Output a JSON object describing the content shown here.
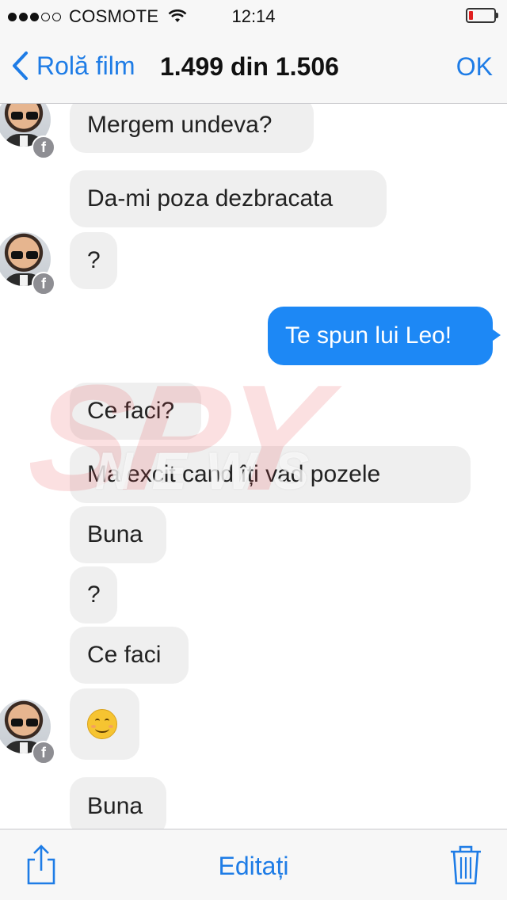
{
  "status_bar": {
    "signal_dots_full": 3,
    "signal_dots_total": 5,
    "carrier": "COSMOTE",
    "wifi_icon": "wifi-icon",
    "time": "12:14",
    "battery_icon": "battery-low-icon",
    "battery_color": "#e02020"
  },
  "nav": {
    "back_label": "Rolă film",
    "title": "1.499 din 1.506",
    "ok_label": "OK",
    "accent_color": "#1e7ce6"
  },
  "messages": [
    {
      "direction": "in",
      "text": "Mergem undeva?",
      "avatar": true
    },
    {
      "direction": "in",
      "text": "Da-mi poza dezbracata",
      "avatar": false
    },
    {
      "direction": "in",
      "text": "?",
      "avatar": true
    },
    {
      "direction": "out",
      "text": "Te spun lui Leo!"
    },
    {
      "direction": "in",
      "text": "Ce faci?",
      "avatar": false
    },
    {
      "direction": "in",
      "text": "Ma excit cand îți vad pozele",
      "avatar": false
    },
    {
      "direction": "in",
      "text": "Buna",
      "avatar": false
    },
    {
      "direction": "in",
      "text": "?",
      "avatar": false
    },
    {
      "direction": "in",
      "text": "Ce faci",
      "avatar": false
    },
    {
      "direction": "in",
      "text": "",
      "emoji": "smiling-face-emoji",
      "avatar": true
    },
    {
      "direction": "in",
      "text": "Buna",
      "avatar": false
    }
  ],
  "avatar_badge": "f",
  "watermark": {
    "main": "SPY",
    "sub": "NEWS"
  },
  "toolbar": {
    "share_icon": "share-icon",
    "edit_label": "Editați",
    "trash_icon": "trash-icon"
  },
  "colors": {
    "outgoing_bubble": "#1d88f5",
    "incoming_bubble": "#efefef"
  }
}
